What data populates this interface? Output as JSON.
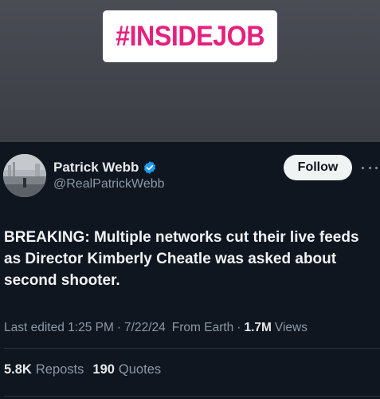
{
  "story": {
    "hashtag": "#INSIDEJOB",
    "hashtag_color": "#e5207d"
  },
  "tweet": {
    "author": {
      "name": "Patrick Webb",
      "handle": "@RealPatrickWebb",
      "verified": true
    },
    "follow_label": "Follow",
    "more_icon": "more-horizontal-icon",
    "text": "BREAKING: Multiple networks cut their live feeds as Director Kimberly Cheatle was asked about second shooter.",
    "meta": {
      "edited": "Last edited 1:25 PM",
      "date": "7/22/24",
      "location": "From Earth",
      "views_count": "1.7M",
      "views_label": "Views"
    },
    "stats": {
      "reposts_count": "5.8K",
      "reposts_label": "Reposts",
      "quotes_count": "190",
      "quotes_label": "Quotes"
    }
  },
  "colors": {
    "verified_badge": "#1d9bf0",
    "follow_bg": "#eff3f4",
    "muted_text": "#8b98a5"
  }
}
